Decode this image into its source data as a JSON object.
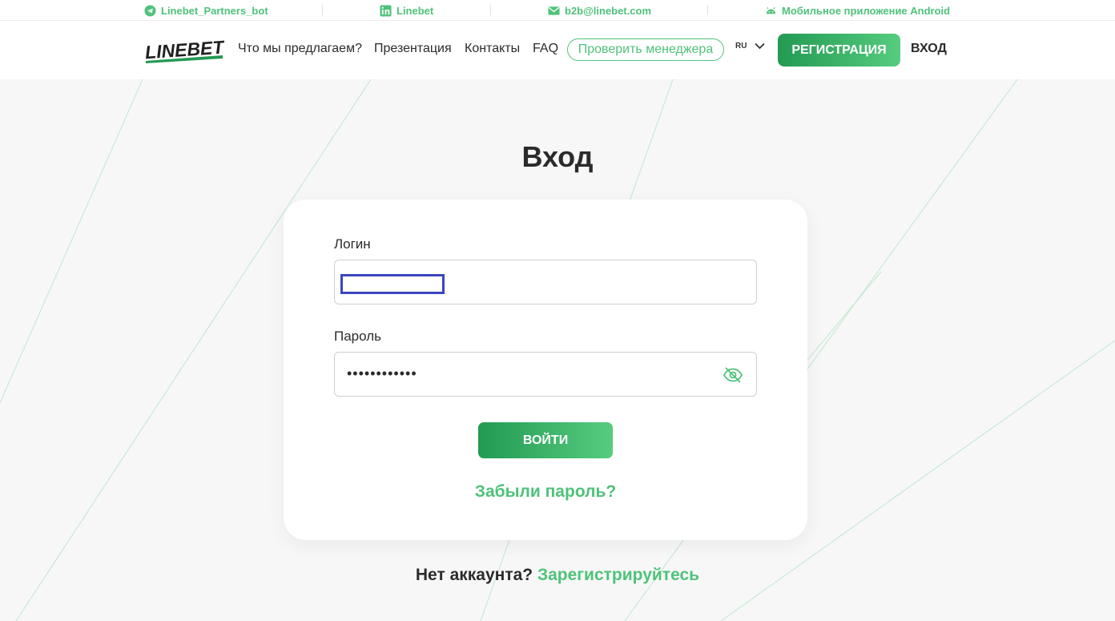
{
  "topbar": {
    "telegram": "Linebet_Partners_bot",
    "linkedin": "Linebet",
    "email": "b2b@linebet.com",
    "android": "Мобильное приложение Android"
  },
  "header": {
    "logo_text": "LINEBET",
    "nav": [
      "Что мы предлагаем?",
      "Презентация",
      "Контакты",
      "FAQ"
    ],
    "check_manager": "Проверить менеджера",
    "lang": "RU",
    "register": "РЕГИСТРАЦИЯ",
    "login": "ВХОД"
  },
  "main": {
    "title": "Вход",
    "login_label": "Логин",
    "login_value": "",
    "password_label": "Пароль",
    "password_value": "••••••••••••",
    "submit": "ВОЙТИ",
    "forgot": "Забыли пароль?",
    "no_account": "Нет аккаунта?",
    "register_link": "Зарегистрируйтесь"
  },
  "colors": {
    "accent": "#4fc27a",
    "accent_dark": "#239a52",
    "focus_outline": "#3a46c0"
  },
  "icons": [
    "telegram-icon",
    "linkedin-icon",
    "email-icon",
    "android-icon",
    "chevron-down-icon",
    "eye-off-icon"
  ]
}
